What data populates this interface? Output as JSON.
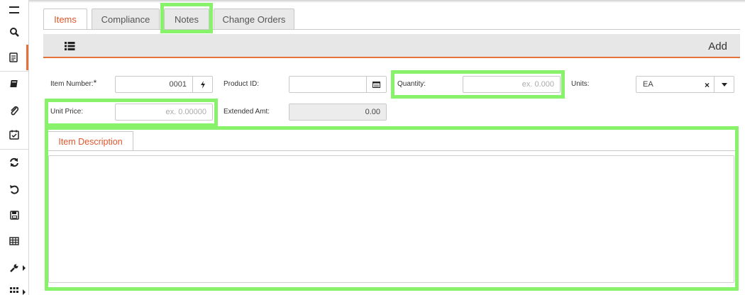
{
  "sidebar": {
    "icons": [
      "menu-icon",
      "search-icon",
      "document-icon",
      "book-icon",
      "paperclip-icon",
      "calendar-check-icon",
      "refresh-icon",
      "undo-icon",
      "save-icon",
      "table-icon",
      "wrench-icon",
      "grid-icon"
    ]
  },
  "tabs": [
    {
      "label": "Items",
      "active": true
    },
    {
      "label": "Compliance",
      "active": false
    },
    {
      "label": "Notes",
      "active": false
    },
    {
      "label": "Change Orders",
      "active": false
    }
  ],
  "toolbar": {
    "add_label": "Add"
  },
  "form": {
    "item_number": {
      "label": "Item Number:",
      "required_mark": "*",
      "value": "0001"
    },
    "product_id": {
      "label": "Product ID:",
      "value": ""
    },
    "quantity": {
      "label": "Quantity:",
      "placeholder": "ex. 0.000"
    },
    "units": {
      "label": "Units:",
      "value": "EA"
    },
    "unit_price": {
      "label": "Unit Price:",
      "placeholder": "ex. 0.00000"
    },
    "extended_amt": {
      "label": "Extended Amt:",
      "value": "0.00"
    }
  },
  "description": {
    "tab_label": "Item Description",
    "value": ""
  },
  "colors": {
    "accent": "#e8703a",
    "active_tab_text": "#e0562b",
    "highlight": "#88f26a"
  }
}
